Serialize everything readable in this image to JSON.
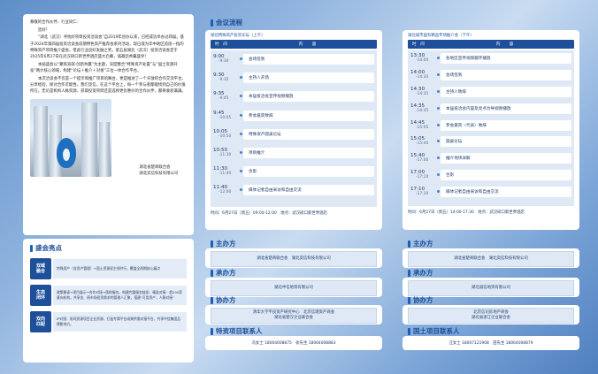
{
  "letter": {
    "greeting": "尊敬的合作伙伴、行业同仁：",
    "hello": "您好！",
    "paras": [
      "“湖北（武汉）寻找好项目投资洽谈会”自2019年创办以来，已经成功举办过四届。基于2024年第四届投资洽谈会前期特色资产推荐会系列活动，现已成为华中地区首屈一指的特殊资产项目推介盛会。借此行业良好发展之势，第五届湖北（武汉）投资洽谈会定于2025年6月27日在武汉硚口新世界酒店盛大启幕，诚邀您共襄盛举！",
      "本届盛会以“聚焦双碳·创新共赢”为主题，深度整合“特殊资产处置”与“国土资源开发”两大核心领域，构建“论坛＋推介＋对接”三位一体合作平台。",
      "本次洽谈会不仅是一个提示和推广项目的舞台，更是推进了一个开放的合作交流平台，分享经验，探讨合作可能性。我们坚信，在这个平台上，每一个参与者都能找到自己的价值所在，无论是机构人脉资源、获取投资项目还是选择更优惠价的合作伙伴，都将收获满满。"
    ],
    "sign1": "湖北省楚商联合会",
    "sign2": "湖北奕信科技有限公司"
  },
  "highlights": {
    "title": "盛会亮点",
    "items": [
      {
        "badge": "双域\n融合",
        "text": "特殊资产（含资产管理）+国土资源双主线并行，覆盖全周期核心痛点"
      },
      {
        "badge": "生态\n闭环",
        "text": "政策解读→项目展示→合作对接→落地服务，构建完整服务链条；精准对接：超200家意向机构，共享金、债市场投资需求的管理人汇聚，搭建“可用资产，人脉对接”"
      },
      {
        "badge": "双向\n匹配",
        "text": "IP对接：协同资源项目企业资源，打造专属平台成果供需对接平台，共享中信集团品牌影响力。"
      }
    ]
  },
  "agenda": {
    "title": "会议流程",
    "th_time": "时　间",
    "th_content": "内　容",
    "morning": {
      "subtitle": "湖北特殊资产投资论坛（上午）",
      "rows": [
        {
          "start": "9:00",
          "end": "-9:30",
          "item": "会场签到"
        },
        {
          "start": "9:30",
          "end": "-9:35",
          "item": "主持人开场"
        },
        {
          "start": "9:35",
          "end": "-9:45",
          "item": "本届投洽会宣传视频播放"
        },
        {
          "start": "9:45",
          "end": "-10:05",
          "item": "参会嘉宾致辞"
        },
        {
          "start": "10:05",
          "end": "-10:50",
          "item": "特殊资产圆桌论坛"
        },
        {
          "start": "10:50",
          "end": "-11:30",
          "item": "项目推介"
        },
        {
          "start": "11:30",
          "end": "-11:40",
          "item": "合影"
        },
        {
          "start": "11:40",
          "end": "-12:00",
          "item": "媒体记者自由采访和自由交流"
        }
      ],
      "foot": "时间：6月27日（周五）09:00-12:00　地点：武汉硚口新世界酒店"
    },
    "afternoon": {
      "subtitle": "湖北城市国有精品专场推介会（下午）",
      "rows": [
        {
          "start": "13:30",
          "end": "-14:00",
          "item": "各地区宣传视频循环播放"
        },
        {
          "start": "14:00",
          "end": "-14:30",
          "item": "会场签到"
        },
        {
          "start": "14:30",
          "end": "-14:35",
          "item": "主持人致辞"
        },
        {
          "start": "14:35",
          "end": "-14:45",
          "item": "本届投洽会内容及亮点为导视频播放"
        },
        {
          "start": "14:45",
          "end": "-15:05",
          "item": "参会嘉宾（代表）致辞"
        },
        {
          "start": "15:05",
          "end": "-15:40",
          "item": "圆桌论坛"
        },
        {
          "start": "15:40",
          "end": "-17:00",
          "item": "推介地块详解"
        },
        {
          "start": "17:00",
          "end": "-17:10",
          "item": "合影"
        },
        {
          "start": "17:10",
          "end": "-17:30",
          "item": "媒体记者自由采访和自由交流"
        }
      ],
      "foot": "时间：6月27日（周五）14:00-17:30　地点：武汉硚口新世界酒店"
    }
  },
  "orgs": {
    "host_title": "主办方",
    "host_left": "湖北省楚商联合会　湖北奕信科技有限公司",
    "host_right": "湖北省楚商联合会　湖北奕信科技有限公司",
    "organizer_title": "承办方",
    "organizer_left": "湖北中信地资有限公司",
    "organizer_right": "湖北诚信地资有限公司",
    "co_title": "协办方",
    "co_left_1": "清华大学不良资产研究中心　北京信理资产商会",
    "co_left_2": "湖北省楚汉企业联合会",
    "co_right_1": "北京信司房地产商会",
    "co_right_2": "湖北省浙江企业联合会",
    "contact_left_title": "特资项目联系人",
    "contact_left": "冯女士 18064008875　徐先生 18064008883",
    "contact_right_title": "国土项目联系人",
    "contact_right": "汪女士 18007121908　田先生 18064008879"
  }
}
